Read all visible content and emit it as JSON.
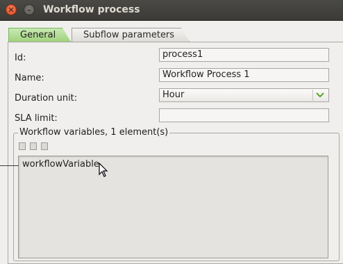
{
  "window": {
    "title": "Workflow process",
    "close_glyph": "✕",
    "min_glyph": "–"
  },
  "tabs": [
    {
      "label": "General",
      "active": true
    },
    {
      "label": "Subflow parameters",
      "active": false
    }
  ],
  "form": {
    "id_label": "Id:",
    "id_value": "process1",
    "name_label": "Name:",
    "name_value": "Workflow Process 1",
    "duration_label": "Duration unit:",
    "duration_value": "Hour",
    "sla_label": "SLA limit:",
    "sla_value": ""
  },
  "variables": {
    "group_title": "Workflow variables, 1 element(s)",
    "toolbar_icons": [
      "new-icon",
      "edit-icon",
      "delete-icon"
    ],
    "items": [
      "workflowVariable"
    ]
  },
  "colors": {
    "active_tab": "#a8d78a",
    "titlebar": "#3c3b37",
    "combo_arrow": "#5aa12e"
  }
}
